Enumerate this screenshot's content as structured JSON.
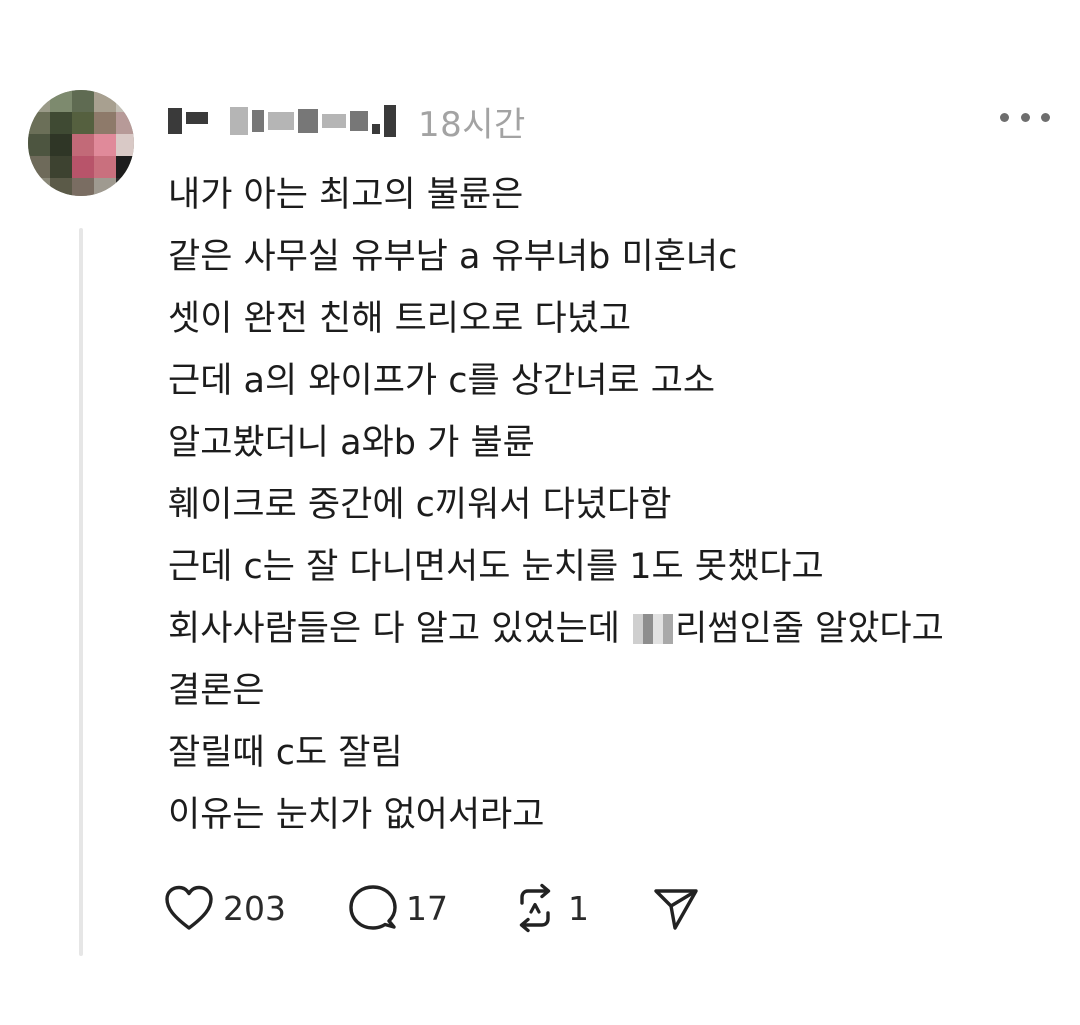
{
  "post": {
    "author": {
      "display_name": "",
      "avatar_icon": "avatar-icon"
    },
    "timestamp": "18시간",
    "more_icon": "more-horizontal-icon",
    "lines": [
      "내가 아는 최고의 불륜은",
      "같은 사무실 유부남 a 유부녀b 미혼녀c",
      "셋이 완전 친해 트리오로 다녔고",
      "근데 a의 와이프가 c를 상간녀로 고소",
      "알고봤더니 a와b 가 불륜",
      "훼이크로 중간에 c끼워서 다녔다함",
      "근데 c는 잘 다니면서도 눈치를 1도 못챘다고",
      "회사사람들은 다 알고 있었는데 ",
      "결론은",
      "잘릴때 c도 잘림",
      "이유는 눈치가 없어서라고"
    ],
    "line8_tail": "리썸인줄 알았다고",
    "actions": {
      "like": {
        "icon": "heart-icon",
        "count": "203"
      },
      "reply": {
        "icon": "comment-icon",
        "count": "17"
      },
      "repost": {
        "icon": "repost-icon",
        "count": "1"
      },
      "share": {
        "icon": "send-icon"
      }
    }
  }
}
